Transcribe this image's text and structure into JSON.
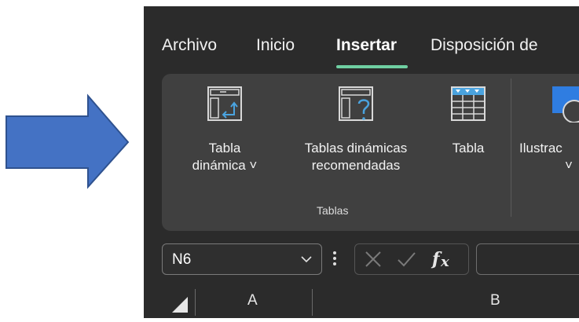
{
  "ribbon_tabs": [
    "Archivo",
    "Inicio",
    "Insertar",
    "Disposición de"
  ],
  "active_tab": "Insertar",
  "accent_color": "#6fcfa2",
  "arrow_color": "#4472c4",
  "buttons": {
    "tabla_dinamica": [
      "Tabla",
      "dinámica ˅"
    ],
    "tablas_dinamicas_recomendadas": [
      "Tablas dinámicas",
      "recomendadas"
    ],
    "tabla": [
      "Tabla"
    ],
    "ilustraciones": [
      "Ilustrac",
      "˅"
    ]
  },
  "group_label": "Tablas",
  "name_box": {
    "value": "N6",
    "chevron": "˅"
  },
  "columns": [
    "A",
    "B"
  ],
  "icons": [
    "arrow-right",
    "pivot-table-icon",
    "recommended-pivot-icon",
    "table-icon",
    "illustrations-icon",
    "cancel-icon",
    "enter-icon",
    "function-icon"
  ]
}
